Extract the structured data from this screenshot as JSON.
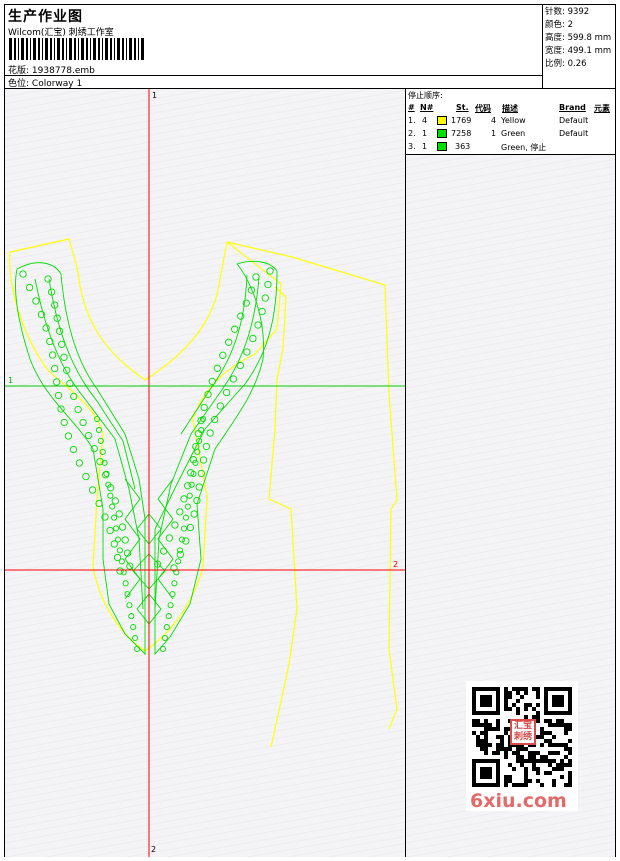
{
  "header": {
    "title": "生产作业图",
    "company": "Wilcom(汇宝) 刺绣工作室",
    "design_label": "花版:",
    "design_value": "1938778.emb",
    "colorway_label": "色位:",
    "colorway_value": "Colorway 1"
  },
  "stats": {
    "stitches_label": "针数:",
    "stitches_value": "9392",
    "colors_label": "颜色:",
    "colors_value": "2",
    "height_label": "高度:",
    "height_value": "599.8 mm",
    "width_label": "宽度:",
    "width_value": "499.1 mm",
    "scale_label": "比例:",
    "scale_value": "0.26"
  },
  "stop_sequence": {
    "title": "停止顺序:",
    "columns": {
      "hash": "#",
      "no": "N#",
      "st": "St.",
      "code": "代码",
      "desc": "描述",
      "brand": "Brand",
      "element": "元素"
    },
    "rows": [
      {
        "idx": "1.",
        "n": "4",
        "color": "#ffff00",
        "st": "1769",
        "code": "4",
        "desc": "Yellow",
        "brand": "Default"
      },
      {
        "idx": "2.",
        "n": "1",
        "color": "#00dd00",
        "st": "7258",
        "code": "1",
        "desc": "Green",
        "brand": "Default"
      },
      {
        "idx": "3.",
        "n": "1",
        "color": "#00dd00",
        "st": "363",
        "code": "",
        "desc": "Green, 停止",
        "brand": ""
      }
    ]
  },
  "axes": {
    "v1_top": "1",
    "h1_left": "1",
    "h2_right": "2",
    "v2_bottom": "2"
  },
  "watermark": "6xiu.com",
  "stamp": "汇宝刺绣",
  "colors": {
    "outline": "#ffff00",
    "embroidery": "#00dd00",
    "axis_red": "#ff0000",
    "axis_green": "#00cc00"
  }
}
